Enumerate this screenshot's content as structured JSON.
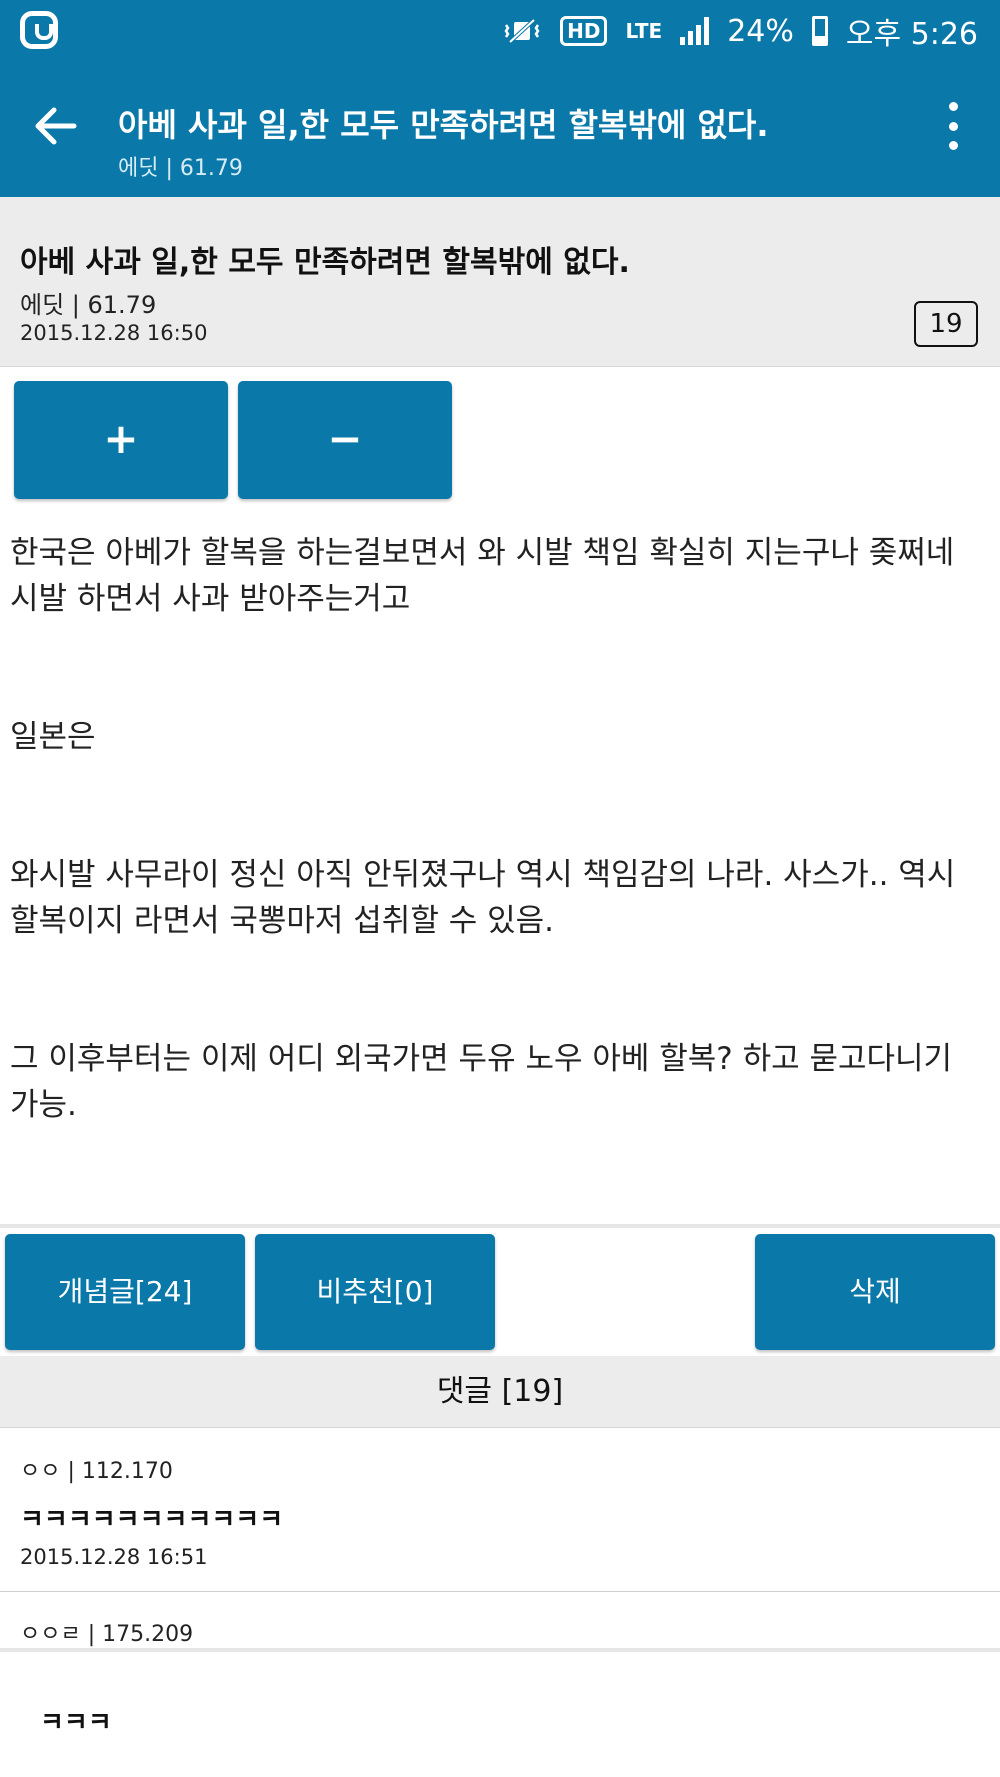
{
  "status_bar": {
    "hd_label": "HD",
    "network_label": "LTE",
    "battery": "24%",
    "time": "오후 5:26",
    "icons": [
      "app-logo-icon",
      "vibrate-icon",
      "hd-icon",
      "lte-icon",
      "signal-icon",
      "battery-icon"
    ]
  },
  "app_bar": {
    "title": "아베 사과 일,한 모두 만족하려면 할복밖에 없다.",
    "subtitle": "에딧 | 61.79",
    "back_icon": "back-arrow-icon",
    "menu_icon": "more-vertical-icon"
  },
  "post": {
    "title": "아베 사과 일,한 모두 만족하려면 할복밖에 없다.",
    "author": "에딧 | 61.79",
    "date": "2015.12.28 16:50",
    "comment_count": "19",
    "upvote_label": "+",
    "downvote_label": "−",
    "paragraphs": [
      "한국은 아베가 할복을 하는걸보면서 와 시발 책임 확실히 지는구나 좆쩌네 시발 하면서 사과 받아주는거고",
      "일본은",
      "와시발 사무라이 정신 아직 안뒤졌구나 역시 책임감의 나라. 사스가.. 역시 할복이지 라면서 국뽕마저 섭취할 수 있음.",
      "그 이후부터는 이제 어디 외국가면 두유 노우 아베 할복? 하고 묻고다니기 가능."
    ]
  },
  "actions": {
    "concept_label": "개념글[24]",
    "nonrec_label": "비추천[0]",
    "delete_label": "삭제"
  },
  "comments_header": "댓글 [19]",
  "comments": [
    {
      "author": "ㅇㅇ | 112.170",
      "text": "ㅋㅋㅋㅋㅋㅋㅋㅋㅋㅋㅋ",
      "date": "2015.12.28 16:51"
    },
    {
      "author": "ㅇㅇㄹ | 175.209",
      "text": "ㅋㅋㅋ"
    }
  ],
  "colors": {
    "primary": "#0a78a8",
    "header_gray": "#ececec"
  }
}
